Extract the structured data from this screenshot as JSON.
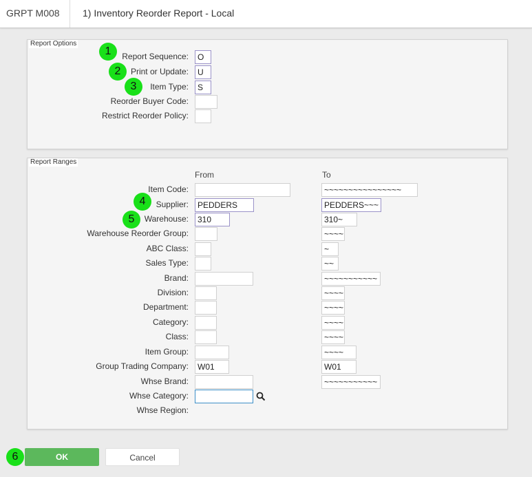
{
  "header": {
    "program_code": "GRPT M008",
    "title": "1) Inventory Reorder Report - Local"
  },
  "report_options": {
    "legend": "Report Options",
    "report_sequence": {
      "label": "Report Sequence:",
      "value": "O"
    },
    "print_or_update": {
      "label": "Print or Update:",
      "value": "U"
    },
    "item_type": {
      "label": "Item Type:",
      "value": "S"
    },
    "reorder_buyer_code": {
      "label": "Reorder Buyer Code:",
      "value": ""
    },
    "restrict_reorder_policy": {
      "label": "Restrict Reorder Policy:",
      "value": ""
    }
  },
  "report_ranges": {
    "legend": "Report Ranges",
    "from_header": "From",
    "to_header": "To",
    "rows": [
      {
        "label": "Item Code:",
        "from": "",
        "to": "~~~~~~~~~~~~~~~~"
      },
      {
        "label": "Supplier:",
        "from": "PEDDERS",
        "to": "PEDDERS~~~"
      },
      {
        "label": "Warehouse:",
        "from": "310",
        "to": "310~"
      },
      {
        "label": "Warehouse Reorder Group:",
        "from": "",
        "to": "~~~~"
      },
      {
        "label": "ABC Class:",
        "from": "",
        "to": "~"
      },
      {
        "label": "Sales Type:",
        "from": "",
        "to": "~~"
      },
      {
        "label": "Brand:",
        "from": "",
        "to": "~~~~~~~~~~~"
      },
      {
        "label": "Division:",
        "from": "",
        "to": "~~~~"
      },
      {
        "label": "Department:",
        "from": "",
        "to": "~~~~"
      },
      {
        "label": "Category:",
        "from": "",
        "to": "~~~~"
      },
      {
        "label": "Class:",
        "from": "",
        "to": "~~~~"
      },
      {
        "label": "Item Group:",
        "from": "",
        "to": "~~~~"
      },
      {
        "label": "Group Trading Company:",
        "from": "W01",
        "to": "W01"
      },
      {
        "label": "Whse Brand:",
        "from": "",
        "to": "~~~~~~~~~~~"
      },
      {
        "label": "Whse Category:",
        "from": ""
      },
      {
        "label": "Whse Region:"
      }
    ]
  },
  "badges": [
    "1",
    "2",
    "3",
    "4",
    "5",
    "6"
  ],
  "buttons": {
    "ok": "OK",
    "cancel": "Cancel"
  },
  "icons": {
    "search": "search-icon"
  },
  "colors": {
    "badge": "#19e019",
    "ok_button": "#5cb85c",
    "focus_border": "#3b8ec7"
  }
}
